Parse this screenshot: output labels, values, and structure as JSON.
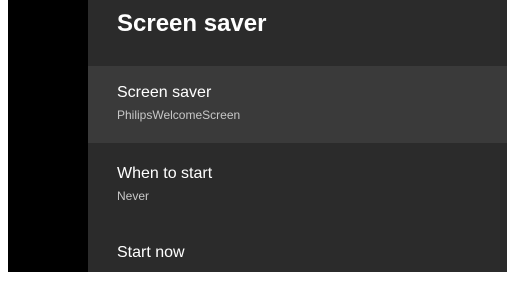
{
  "page": {
    "title": "Screen saver"
  },
  "menu": {
    "items": [
      {
        "label": "Screen saver",
        "value": "PhilipsWelcomeScreen",
        "selected": true
      },
      {
        "label": "When to start",
        "value": "Never",
        "selected": false
      },
      {
        "label": "Start now",
        "value": "",
        "selected": false
      }
    ]
  },
  "colors": {
    "panel_background": "#2b2b2b",
    "selected_background": "#3a3a3a",
    "text_primary": "#ffffff",
    "text_secondary": "#c7c7c7"
  }
}
